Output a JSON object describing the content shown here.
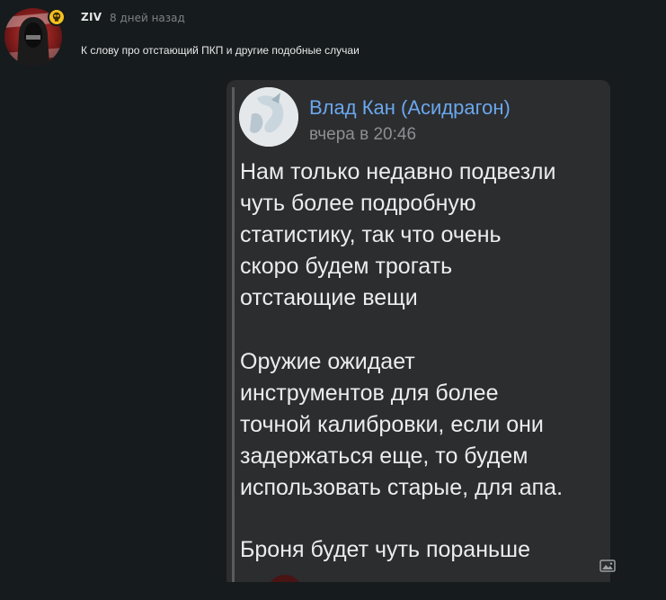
{
  "post": {
    "author": "ZIV",
    "time": "8 дней назад",
    "text": "К слову про отстающий ПКП и другие подобные случаи",
    "avatar_icon": "hooded-figure-avatar",
    "badge_icon": "skull-badge-icon"
  },
  "quote": {
    "name": "Влад Кан (Асидрагон)",
    "time": "вчера в 20:46",
    "paragraphs": [
      "Нам только недавно подвезли\nчуть более подробную\nстатистику, так что очень\nскоро будем трогать\nотстающие вещи",
      "Оружие ожидает\nинструментов для более\nточной калибровки, если они\nзадержаться еще, то будем\nиспользовать старые, для апа.",
      "Броня будет чуть пораньше"
    ]
  },
  "colors": {
    "background": "#161b1d",
    "card": "#2c2d2f",
    "name_link": "#6aa8ee",
    "badge": "#f4c21f"
  }
}
